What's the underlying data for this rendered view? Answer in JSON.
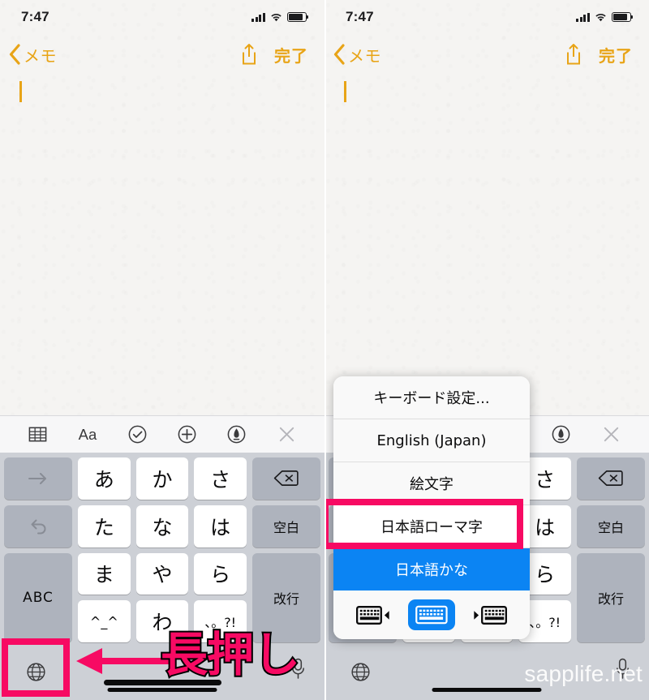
{
  "colors": {
    "accent_gold": "#e8a417",
    "highlight_pink": "#f70a63",
    "ios_blue": "#0b84f3",
    "keyboard_bg": "#cdd0d6",
    "key_white": "#ffffff",
    "key_gray": "#aeb3bd"
  },
  "status_bar": {
    "time": "7:47",
    "signal_icon": "cellular-bars-icon",
    "wifi_icon": "wifi-icon",
    "battery_icon": "battery-icon"
  },
  "nav_bar": {
    "back_icon": "chevron-left-icon",
    "back_label": "メモ",
    "share_icon": "share-icon",
    "done_label": "完了"
  },
  "note": {
    "body_text": "",
    "caret": "text-cursor"
  },
  "note_toolbar": {
    "items": [
      {
        "name": "table-icon",
        "label": "表"
      },
      {
        "name": "format-aa-icon",
        "label": "Aa"
      },
      {
        "name": "checklist-icon",
        "label": "✓"
      },
      {
        "name": "add-attachment-icon",
        "label": "+"
      },
      {
        "name": "markup-pen-icon",
        "label": "✎"
      },
      {
        "name": "close-keyboard-icon",
        "label": "✕"
      }
    ]
  },
  "keyboard": {
    "rows": [
      [
        {
          "label": "→",
          "type": "fn",
          "name": "cursor-right-key"
        },
        {
          "label": "あ",
          "type": "key",
          "name": "key-a"
        },
        {
          "label": "か",
          "type": "key",
          "name": "key-ka"
        },
        {
          "label": "さ",
          "type": "key",
          "name": "key-sa"
        },
        {
          "label": "⌫",
          "type": "fn",
          "name": "delete-key"
        }
      ],
      [
        {
          "label": "↺",
          "type": "fn",
          "name": "undo-key"
        },
        {
          "label": "た",
          "type": "key",
          "name": "key-ta"
        },
        {
          "label": "な",
          "type": "key",
          "name": "key-na"
        },
        {
          "label": "は",
          "type": "key",
          "name": "key-ha"
        },
        {
          "label": "空白",
          "type": "fn",
          "name": "space-key"
        }
      ],
      [
        {
          "label": "ABC",
          "type": "fn",
          "name": "abc-key"
        },
        {
          "label": "ま",
          "type": "key",
          "name": "key-ma"
        },
        {
          "label": "や",
          "type": "key",
          "name": "key-ya"
        },
        {
          "label": "ら",
          "type": "key",
          "name": "key-ra"
        },
        {
          "label": "改行",
          "type": "fn",
          "name": "return-key"
        }
      ],
      [
        {
          "label": "ABC",
          "type": "fn",
          "name": "abc-key"
        },
        {
          "label": "^_^",
          "type": "key",
          "name": "key-kaomoji"
        },
        {
          "label": "わ",
          "type": "key",
          "name": "key-wa"
        },
        {
          "label": "、。?!",
          "type": "key",
          "name": "key-punctuation"
        },
        {
          "label": "改行",
          "type": "fn",
          "name": "return-key"
        }
      ]
    ],
    "globe_key": "globe-icon",
    "mic_key": "microphone-icon",
    "home_indicator": "home-indicator"
  },
  "annotation": {
    "long_press_text": "長押し",
    "arrow_icon": "left-arrow-annotation",
    "highlight_target": "globe-key-highlight"
  },
  "popup_menu": {
    "items": [
      {
        "label": "キーボード設定...",
        "state": "normal",
        "name": "keyboard-settings-item"
      },
      {
        "label": "English (Japan)",
        "state": "normal",
        "name": "english-japan-item"
      },
      {
        "label": "絵文字",
        "state": "normal",
        "name": "emoji-item"
      },
      {
        "label": "日本語ローマ字",
        "state": "highlighted",
        "name": "japanese-romaji-item"
      },
      {
        "label": "日本語かな",
        "state": "selected",
        "name": "japanese-kana-item"
      }
    ],
    "layout_modes": [
      {
        "name": "keyboard-left-split-icon",
        "active": false
      },
      {
        "name": "keyboard-full-icon",
        "active": true
      },
      {
        "name": "keyboard-right-split-icon",
        "active": false
      }
    ]
  },
  "watermark": {
    "text": "sapplife.net"
  }
}
